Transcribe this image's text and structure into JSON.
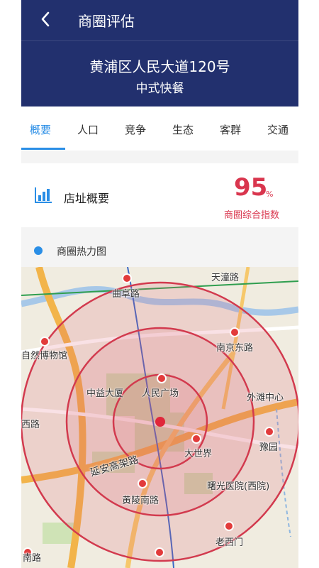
{
  "header": {
    "title": "商圈评估",
    "address": "黄浦区人民大道120号",
    "category": "中式快餐"
  },
  "tabs": [
    {
      "label": "概要",
      "active": true
    },
    {
      "label": "人口",
      "active": false
    },
    {
      "label": "竞争",
      "active": false
    },
    {
      "label": "生态",
      "active": false
    },
    {
      "label": "客群",
      "active": false
    },
    {
      "label": "交通",
      "active": false
    }
  ],
  "overview": {
    "label": "店址概要",
    "score": "95",
    "score_unit": "%",
    "score_caption": "商圈综合指数",
    "icon": "bar-chart-icon"
  },
  "heatmap": {
    "label": "商圈热力图",
    "map_labels": [
      "天潼路",
      "曲阜路",
      "南京东路",
      "自然博物馆",
      "中益大厦",
      "人民广场",
      "外滩中心",
      "西路",
      "豫园",
      "大世界",
      "延安高架路",
      "曙光医院(西院)",
      "黄陵南路",
      "老西门",
      "南路"
    ]
  },
  "colors": {
    "header_bg": "#22306e",
    "accent": "#2a8ee6",
    "score": "#d9364e"
  }
}
